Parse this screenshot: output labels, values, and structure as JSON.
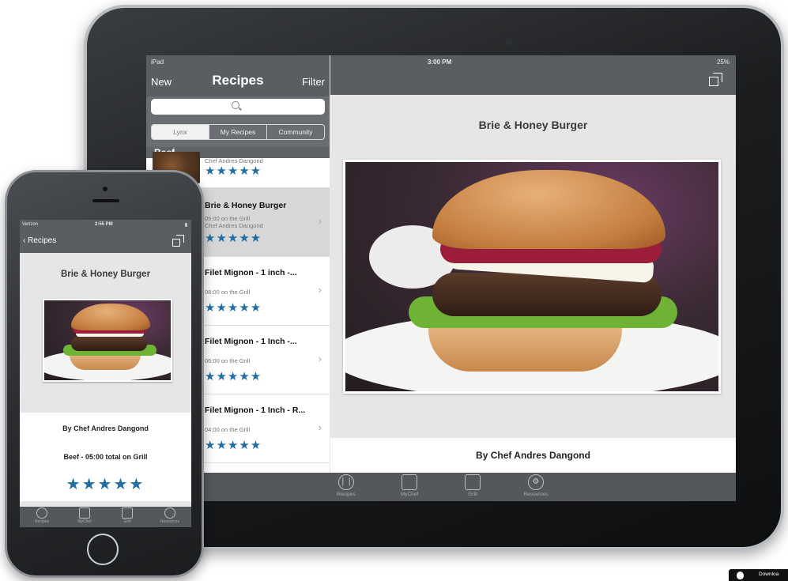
{
  "ipad": {
    "status": {
      "carrier": "iPad",
      "time": "3:00 PM",
      "battery": "25%"
    },
    "master": {
      "nav_new": "New",
      "nav_title": "Recipes",
      "nav_filter": "Filter",
      "segments": [
        "Lynx",
        "My Recipes",
        "Community"
      ],
      "section_header": "Beef",
      "rows": [
        {
          "title": "",
          "subtitle": "Chef Andres Dangond",
          "subtitle2": "",
          "stars": "★★★★★"
        },
        {
          "title": "Brie & Honey Burger",
          "subtitle": "05:00 on the Grill",
          "subtitle2": "Chef Andres Dangond",
          "stars": "★★★★★"
        },
        {
          "title": "Filet Mignon - 1 inch -...",
          "subtitle": "08:00 on the Grill",
          "subtitle2": "",
          "stars": "★★★★★"
        },
        {
          "title": "Filet Mignon - 1 Inch -...",
          "subtitle": "06:00 on the Grill",
          "subtitle2": "",
          "stars": "★★★★★"
        },
        {
          "title": "Filet Mignon - 1 Inch - R...",
          "subtitle": "04:00 on the Grill",
          "subtitle2": "",
          "stars": "★★★★★"
        }
      ]
    },
    "detail": {
      "title": "Brie & Honey Burger",
      "author": "By Chef Andres Dangond"
    },
    "tabbar": [
      "Recipes",
      "MyChef",
      "Grill",
      "Resources"
    ]
  },
  "iphone": {
    "status": {
      "carrier": "Verizon",
      "time": "2:55 PM"
    },
    "back_label": "Recipes",
    "title": "Brie & Honey Burger",
    "author": "By Chef Andres Dangond",
    "meta": "Beef - 05:00 total on Grill",
    "stars": "★★★★★",
    "tabbar": [
      "Recipes",
      "MyChef",
      "Grill",
      "Resources"
    ]
  },
  "badge": {
    "text": "Downloa"
  },
  "colors": {
    "nav_bar": "#5a5e63",
    "star_blue": "#1f6fa5",
    "selected_row": "#d7d7d7"
  }
}
